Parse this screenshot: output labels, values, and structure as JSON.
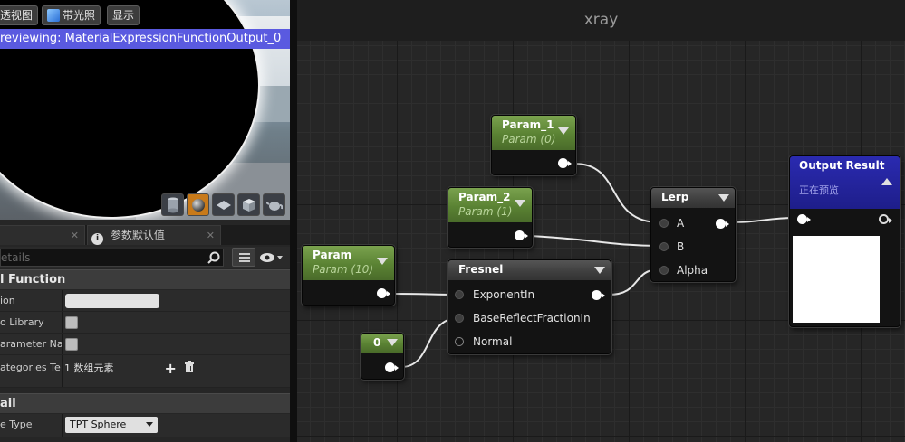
{
  "viewport": {
    "buttons": [
      {
        "label": "透视图"
      },
      {
        "label": "带光照"
      },
      {
        "label": "显示"
      }
    ],
    "preview_text": "reviewing: MaterialExpressionFunctionOutput_0",
    "tool_icons": [
      "cylinder-icon",
      "sphere-icon",
      "plane-icon",
      "cube-icon",
      "teapot-icon"
    ]
  },
  "details": {
    "tabs": [
      {
        "label": ""
      },
      {
        "label": "参数默认值"
      }
    ],
    "search_placeholder": "etails",
    "section_function": "l Function",
    "rows": [
      {
        "name": "ion"
      },
      {
        "name": "o Library"
      },
      {
        "name": "arameter Nam"
      },
      {
        "name": "ategories Te:",
        "value": "1 数组元素"
      }
    ],
    "section_detail": "ail",
    "preview_type": {
      "name": "e Type",
      "value": "TPT Sphere"
    }
  },
  "graph": {
    "title": "xray",
    "nodes": {
      "param1": {
        "title": "Param_1",
        "subtitle": "Param (0)"
      },
      "param2": {
        "title": "Param_2",
        "subtitle": "Param (1)"
      },
      "param": {
        "title": "Param",
        "subtitle": "Param (10)"
      },
      "fresnel": {
        "title": "Fresnel",
        "inputs": [
          "ExponentIn",
          "BaseReflectFractionIn",
          "Normal"
        ]
      },
      "const0": {
        "title": "0"
      },
      "lerp": {
        "title": "Lerp",
        "inputs": [
          "A",
          "B",
          "Alpha"
        ]
      },
      "output": {
        "title": "Output Result",
        "subtitle": "正在预览",
        "preview_color": "#ffffff"
      }
    }
  }
}
